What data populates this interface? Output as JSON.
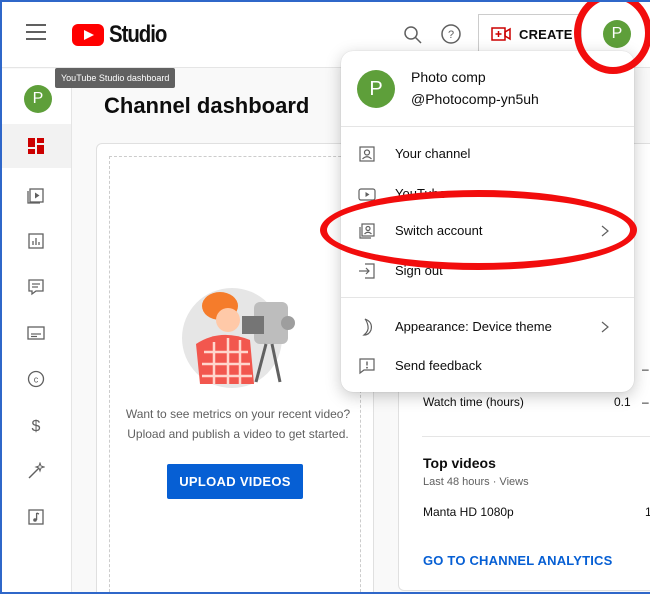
{
  "header": {
    "logo_text": "Studio",
    "create_label": "CREATE",
    "avatar_letter": "P"
  },
  "tooltip": "YouTube Studio dashboard",
  "sidebar": {
    "avatar_letter": "P",
    "items": [
      "dashboard-icon",
      "content-icon",
      "analytics-icon",
      "comments-icon",
      "subtitles-icon",
      "copyright-icon",
      "earn-icon",
      "customization-icon",
      "audio-library-icon"
    ]
  },
  "main": {
    "title": "Channel dashboard",
    "card_message": "Want to see metrics on your recent video? Upload and publish a video to get started.",
    "upload_label": "UPLOAD VIDEOS",
    "metric_dash_top": "–",
    "watch_time_label": "Watch time (hours)",
    "watch_time_value": "0.1",
    "watch_time_dash": "–",
    "top_videos_title": "Top videos",
    "top_videos_sub": "Last 48 hours · Views",
    "video_name": "Manta HD 1080p",
    "video_value": "1",
    "analytics_link": "GO TO CHANNEL ANALYTICS"
  },
  "menu": {
    "avatar_letter": "P",
    "name": "Photo comp",
    "handle": "@Photocomp-yn5uh",
    "items": {
      "your_channel": "Your channel",
      "youtube": "YouTube",
      "switch_account": "Switch account",
      "sign_out": "Sign out",
      "appearance": "Appearance: Device theme",
      "send_feedback": "Send feedback"
    }
  },
  "colors": {
    "accent_blue": "#065fd4",
    "avatar_green": "#5e9f3a",
    "annotation_red": "#f20d0d"
  }
}
